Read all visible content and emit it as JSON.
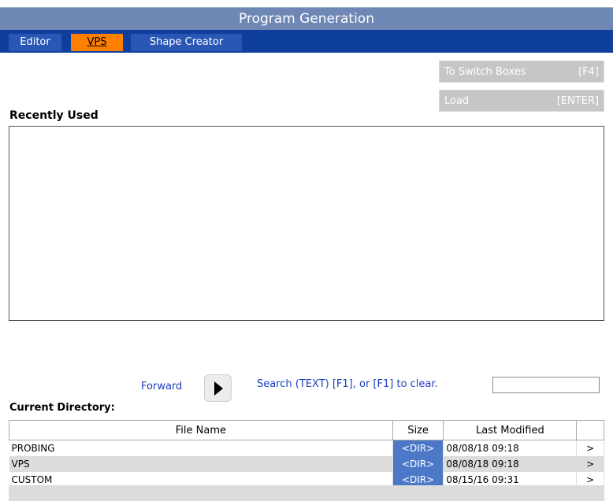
{
  "window": {
    "title": "Program Generation"
  },
  "tabs": [
    {
      "label": "Editor",
      "active": false
    },
    {
      "label": "VPS",
      "active": true
    },
    {
      "label": "Shape Creator",
      "active": false
    }
  ],
  "buttons": {
    "switch_boxes": {
      "label": "To Switch Boxes",
      "key": "[F4]"
    },
    "load": {
      "label": "Load",
      "key": "[ENTER]"
    }
  },
  "recently_used": {
    "label": "Recently Used",
    "items": []
  },
  "navigation": {
    "forward_label": "Forward",
    "forward_icon": "play-triangle-icon",
    "search_hint": "Search (TEXT) [F1], or [F1] to clear.",
    "search_value": ""
  },
  "current_directory": {
    "label": "Current Directory:",
    "columns": [
      "File Name",
      "Size",
      "Last Modified",
      ""
    ],
    "rows": [
      {
        "name": "PROBING",
        "size": "<DIR>",
        "modified": "08/08/18 09:18",
        "arrow": ">"
      },
      {
        "name": "VPS",
        "size": "<DIR>",
        "modified": "08/08/18 09:18",
        "arrow": ">"
      },
      {
        "name": "CUSTOM",
        "size": "<DIR>",
        "modified": "08/15/16 09:31",
        "arrow": ">"
      }
    ]
  },
  "colors": {
    "title_bar": "#6f87b4",
    "tab_bar": "#0f3f9c",
    "tab_active": "#ff7f00",
    "dir_badge": "#4d78c8",
    "link_text": "#1b3fc1"
  }
}
